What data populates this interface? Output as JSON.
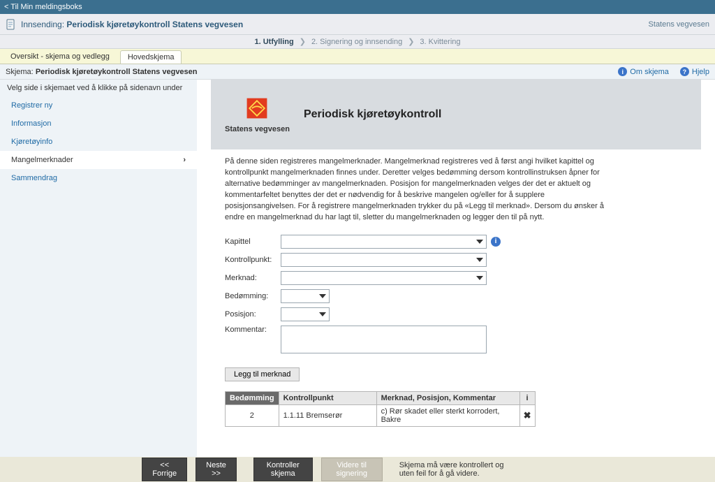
{
  "topbar": {
    "back_link": "< Til Min meldingsboks"
  },
  "header": {
    "label": "Innsending:",
    "title": "Periodisk kjøretøykontroll Statens vegvesen",
    "org": "Statens vegvesen"
  },
  "steps": {
    "s1": "1. Utfylling",
    "s2": "2. Signering og innsending",
    "s3": "3. Kvittering"
  },
  "tabs": {
    "overview": "Oversikt - skjema og vedlegg",
    "main": "Hovedskjema"
  },
  "subheader": {
    "label": "Skjema:",
    "title": "Periodisk kjøretøykontroll Statens vegvesen",
    "about": "Om skjema",
    "help": "Hjelp"
  },
  "sidebar": {
    "instr": "Velg side i skjemaet ved å klikke på sidenavn under",
    "items": [
      {
        "label": "Registrer ny"
      },
      {
        "label": "Informasjon"
      },
      {
        "label": "Kjøretøyinfo"
      },
      {
        "label": "Mangelmerknader"
      },
      {
        "label": "Sammendrag"
      }
    ]
  },
  "banner": {
    "sub": "Statens vegvesen",
    "title": "Periodisk kjøretøykontroll"
  },
  "desc": "På denne siden registreres mangelmerknader. Mangelmerknad registreres ved å først angi hvilket kapittel og kontrollpunkt mangelmerknaden finnes under. Deretter velges bedømming dersom kontrollinstruksen åpner for alternative bedømminger av mangelmerknaden. Posisjon for mangelmerknaden velges der det er aktuelt og kommentarfeltet benyttes der det er nødvendig for å beskrive mangelen og/eller for å supplere posisjonsangivelsen. For å registrere mangelmerknaden trykker du på «Legg til merknad». Dersom du ønsker å endre en mangelmerknad du har lagt til, sletter du mangelmerknaden og legger den til på nytt.",
  "form": {
    "kapittel": "Kapittel",
    "kontrollpunkt": "Kontrollpunkt:",
    "merknad": "Merknad:",
    "bedomming": "Bedømming:",
    "posisjon": "Posisjon:",
    "kommentar": "Kommentar:"
  },
  "buttons": {
    "add": "Legg til merknad"
  },
  "table": {
    "h1": "Bedømming",
    "h2": "Kontrollpunkt",
    "h3": "Merknad, Posisjon, Kommentar",
    "rows": [
      {
        "bed": "2",
        "kp": "1.1.11 Bremserør",
        "mk": "c) Rør skadet eller sterkt korrodert, Bakre"
      }
    ]
  },
  "footer": {
    "prev": "<< Forrige",
    "next": "Neste >>",
    "check": "Kontroller skjema",
    "sign": "Videre til signering",
    "msg": "Skjema må være kontrollert og uten feil for å gå videre."
  }
}
